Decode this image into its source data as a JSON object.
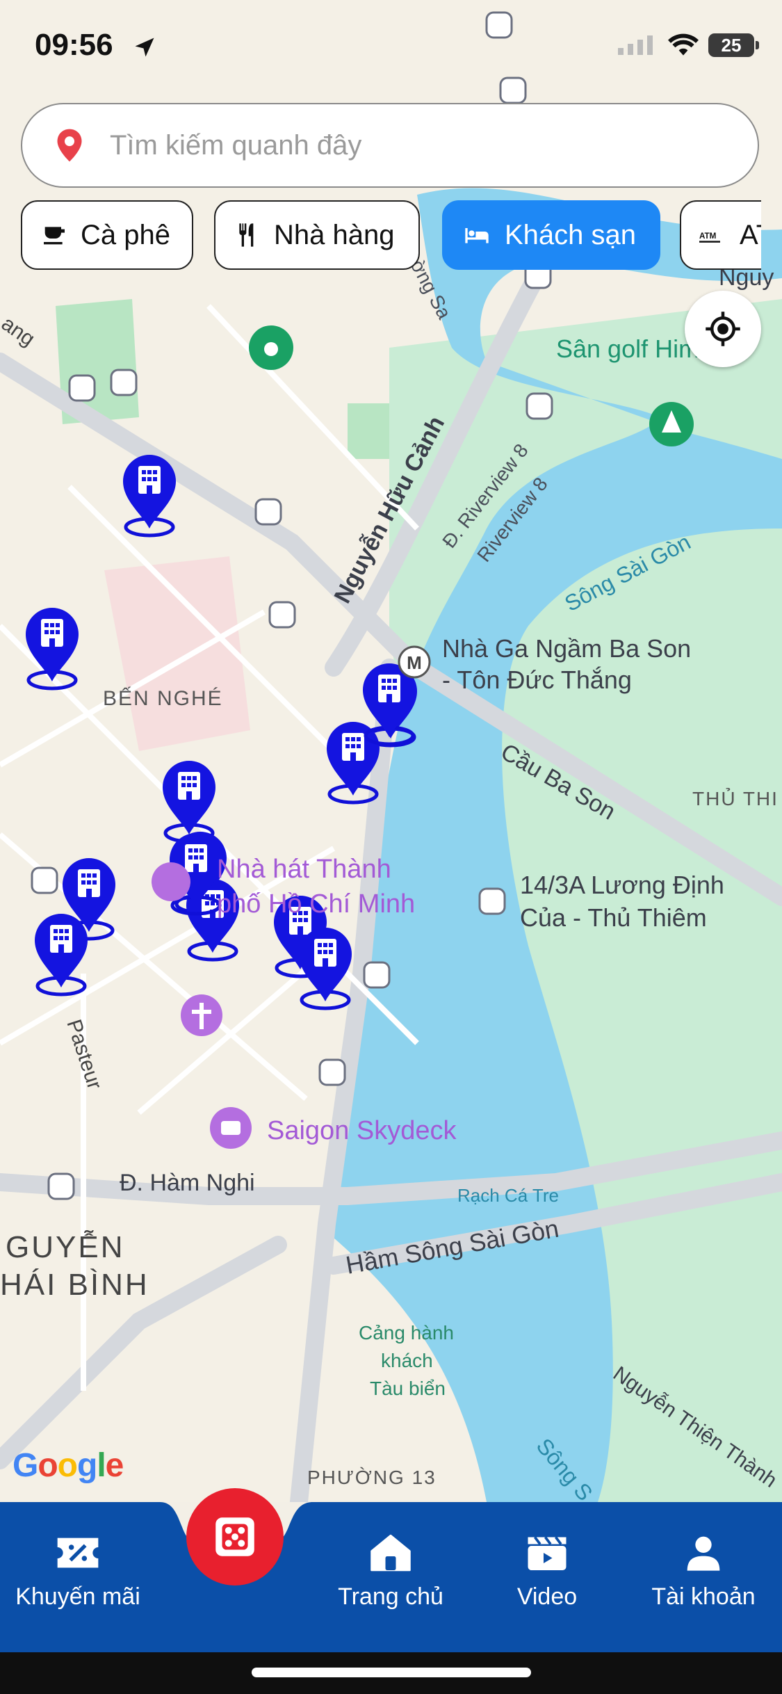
{
  "status_bar": {
    "time": "09:56",
    "battery": "25"
  },
  "search": {
    "placeholder": "Tìm kiếm quanh đây"
  },
  "chips": [
    {
      "label": "Cà phê",
      "icon": "coffee-cup-icon",
      "active": false
    },
    {
      "label": "Nhà hàng",
      "icon": "fork-knife-icon",
      "active": false
    },
    {
      "label": "Khách sạn",
      "icon": "bed-icon",
      "active": true
    },
    {
      "label": "ATM",
      "icon": "atm-icon",
      "active": false
    }
  ],
  "map": {
    "labels": {
      "nguyen_huu_canh": "Nguyễn Hữu Cảnh",
      "riverview8_a": "Đ. Riverview 8",
      "riverview8_b": "Riverview 8",
      "song_sai_gon": "Sông Sài Gòn",
      "nha_ga_1": "Nhà Ga Ngầm Ba Son",
      "nha_ga_2": "- Tôn Đức Thắng",
      "ben_nghe": "BẾN NGHÉ",
      "cau_ba_son": "Cầu Ba Son",
      "thu_thiem": "THỦ THI",
      "nha_hat_1": "Nhà hát Thành",
      "nha_hat_2": "phố Hồ Chí Minh",
      "luong_dinh_1": "14/3A Lương Định",
      "luong_dinh_2": "Của - Thủ Thiêm",
      "pasteur": "Pasteur",
      "saigon_skydeck": "Saigon Skydeck",
      "ham_nghi": "Đ. Hàm Nghi",
      "rach_ca_tre": "Rạch Cá Tre",
      "ham_song": "Hầm Sông Sài Gòn",
      "nguyen_thai_binh_1": "GUYỄN",
      "nguyen_thai_binh_2": "HÁI BÌNH",
      "cang_1": "Cảng hành",
      "cang_2": "khách",
      "cang_3": "Tàu biển",
      "phuong_13": "PHƯỜNG 13",
      "nguyen_thien_thanh": "Nguyễn Thiện Thành",
      "san_golf": "Sân golf Him",
      "nguy": "Nguy",
      "ton_duc": "ờng Sa",
      "song_bottom": "Sông S",
      "ang": "ang"
    },
    "hotel_marker_count": 13
  },
  "google_logo": "Google",
  "nav": [
    {
      "label": "Khuyến mãi",
      "icon": "discount-ticket-icon"
    },
    {
      "label": "",
      "icon": "dice-icon"
    },
    {
      "label": "Trang chủ",
      "icon": "home-icon"
    },
    {
      "label": "Video",
      "icon": "video-clapper-icon"
    },
    {
      "label": "Tài khoản",
      "icon": "user-icon"
    }
  ]
}
